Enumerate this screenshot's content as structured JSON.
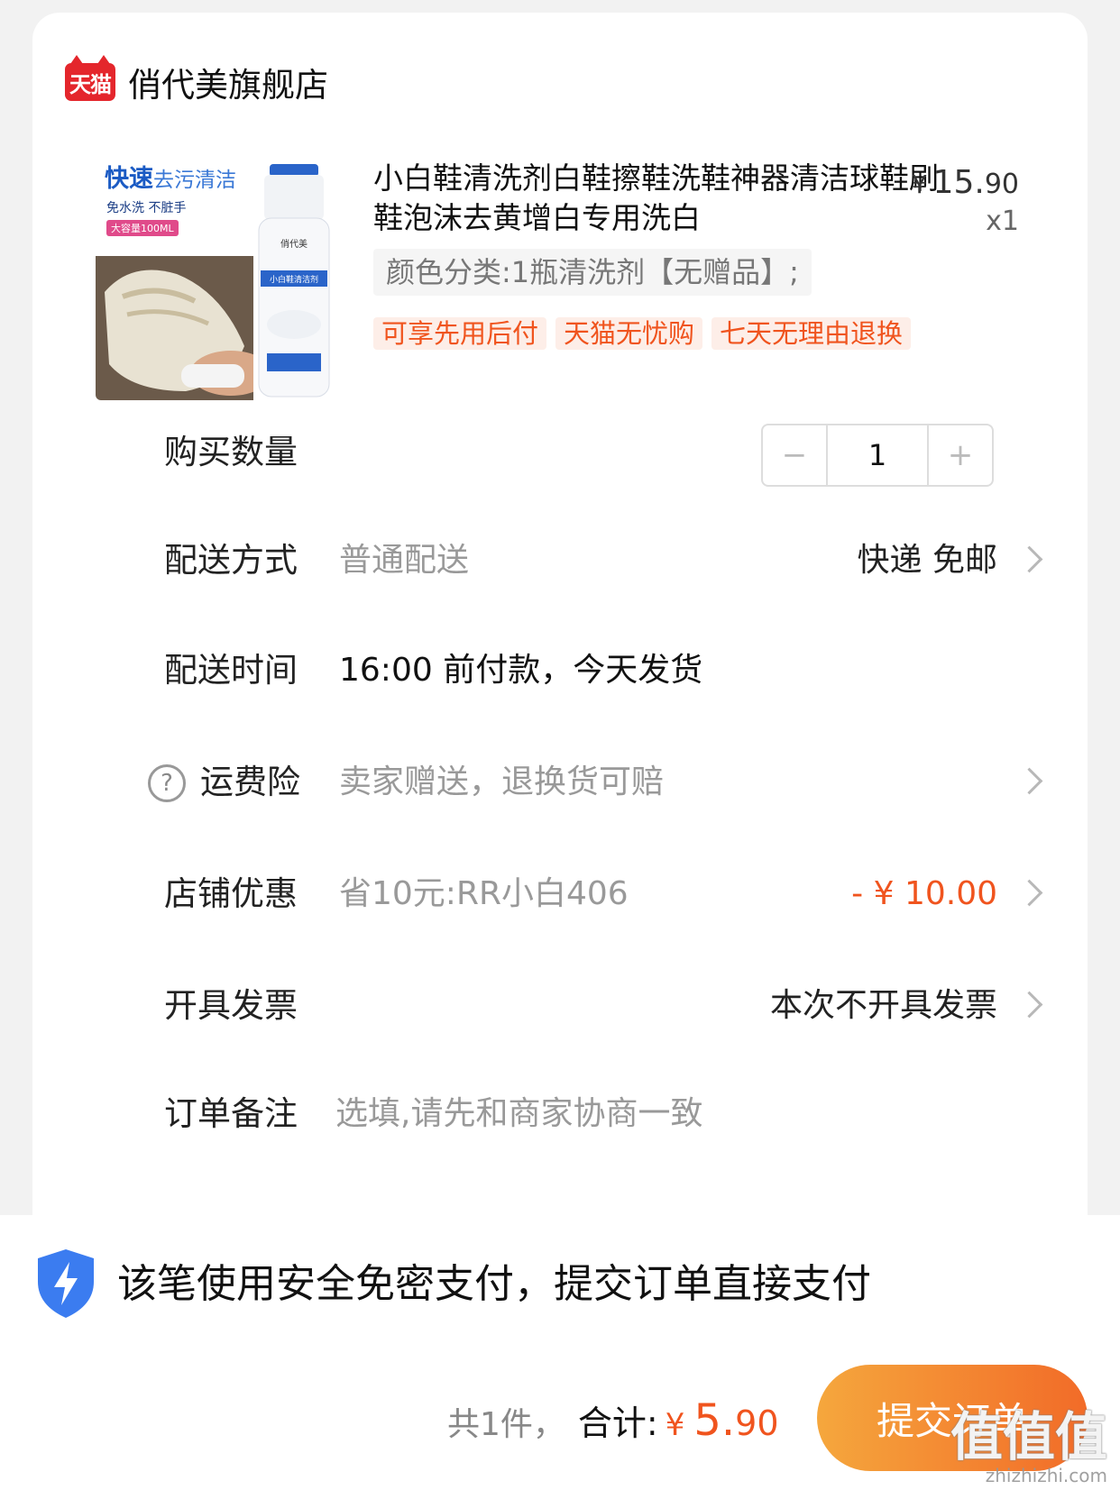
{
  "shop": {
    "platform_logo": "天猫",
    "name": "俏代美旗舰店"
  },
  "product": {
    "image": {
      "headline_bold": "快速",
      "headline": "去污清洁",
      "sub": "免水洗  不脏手",
      "badge": "大容量100ML",
      "bottle_brand": "俏代美",
      "bottle_label": "小白鞋清洁剂"
    },
    "title": "小白鞋清洗剂白鞋擦鞋洗鞋神器清洁球鞋刷鞋泡沫去黄增白专用洗白",
    "price_symbol": "¥",
    "price_int": "15.",
    "price_dec": "90",
    "quantity_text": "x1",
    "sku": "颜色分类:1瓶清洗剂【无赠品】;",
    "tags": [
      "可享先用后付",
      "天猫无忧购",
      "七天无理由退换"
    ]
  },
  "rows": {
    "quantity": {
      "label": "购买数量",
      "value": "1",
      "minus": "−",
      "plus": "+"
    },
    "delivery": {
      "label": "配送方式",
      "value": "普通配送",
      "right": "快递 免邮"
    },
    "delivery_time": {
      "label": "配送时间",
      "value": "16:00 前付款，今天发货"
    },
    "insurance": {
      "label": "运费险",
      "value": "卖家赠送，退换货可赔",
      "icon": "?"
    },
    "discount": {
      "label": "店铺优惠",
      "value": "省10元:RR小白406",
      "right": "- ¥ 10.00"
    },
    "invoice": {
      "label": "开具发票",
      "right": "本次不开具发票"
    },
    "note": {
      "label": "订单备注",
      "placeholder": "选填,请先和商家协商一致"
    }
  },
  "footer": {
    "secure_text": "该笔使用安全免密支付，提交订单直接支付",
    "count": "共1件，",
    "total_label": "合计:",
    "currency": "¥",
    "total_int": "5.",
    "total_dec": "90",
    "submit": "提交订单"
  },
  "watermark": {
    "big": "值值值",
    "small": "zhizhizhi.com"
  },
  "colors": {
    "accent": "#f0541e",
    "tmall_red": "#e4262c",
    "submit_start": "#f5a73d",
    "submit_end": "#f26b28"
  }
}
